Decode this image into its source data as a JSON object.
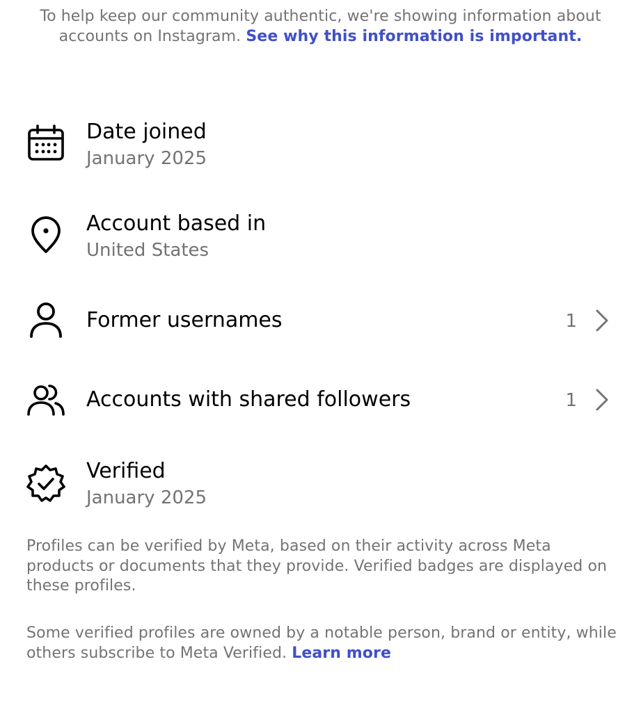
{
  "intro": {
    "text": "To help keep our community authentic, we're showing information about accounts on Instagram.",
    "link": "See why this information is important."
  },
  "items": [
    {
      "icon": "calendar-icon",
      "title": "Date joined",
      "subtitle": "January 2025"
    },
    {
      "icon": "location-pin-icon",
      "title": "Account based in",
      "subtitle": "United States"
    },
    {
      "icon": "person-icon",
      "title": "Former usernames",
      "count": "1"
    },
    {
      "icon": "people-icon",
      "title": "Accounts with shared followers",
      "count": "1"
    },
    {
      "icon": "verified-badge-icon",
      "title": "Verified",
      "subtitle": "January 2025"
    }
  ],
  "notes": {
    "verified_info": "Profiles can be verified by Meta, based on their activity across Meta products or documents that they provide. Verified badges are displayed on these profiles.",
    "subscription_info": "Some verified profiles are owned by a notable person, brand or entity, while others subscribe to Meta Verified.",
    "learn_more": "Learn more"
  },
  "colors": {
    "link": "#4150c8",
    "secondary_text": "#737373",
    "primary_text": "#000000"
  }
}
